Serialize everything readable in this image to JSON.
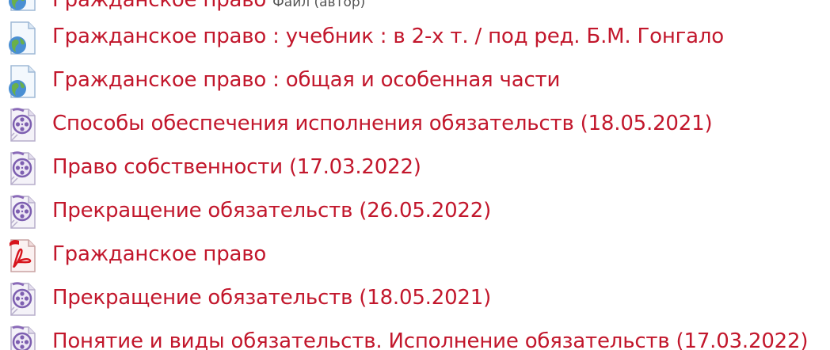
{
  "colors": {
    "link": "#c2172c",
    "meta": "#555555"
  },
  "items": [
    {
      "title": "Гражданское право",
      "meta": "Файл (автор)",
      "icon": "web-resource-icon"
    },
    {
      "title": "Гражданское право : учебник : в 2-х т. / под ред. Б.М. Гонгало",
      "icon": "web-resource-icon"
    },
    {
      "title": "Гражданское право : общая и особенная части",
      "icon": "web-resource-icon"
    },
    {
      "title": "Способы обеспечения исполнения обязательств (18.05.2021)",
      "icon": "video-file-icon"
    },
    {
      "title": "Право собственности (17.03.2022)",
      "icon": "video-file-icon"
    },
    {
      "title": "Прекращение обязательств (26.05.2022)",
      "icon": "video-file-icon"
    },
    {
      "title": "Гражданское право",
      "icon": "pdf-file-icon"
    },
    {
      "title": "Прекращение обязательств (18.05.2021)",
      "icon": "video-file-icon"
    },
    {
      "title": "Понятие и виды обязательств. Исполнение обязательств (17.03.2022)",
      "icon": "video-file-icon"
    }
  ]
}
